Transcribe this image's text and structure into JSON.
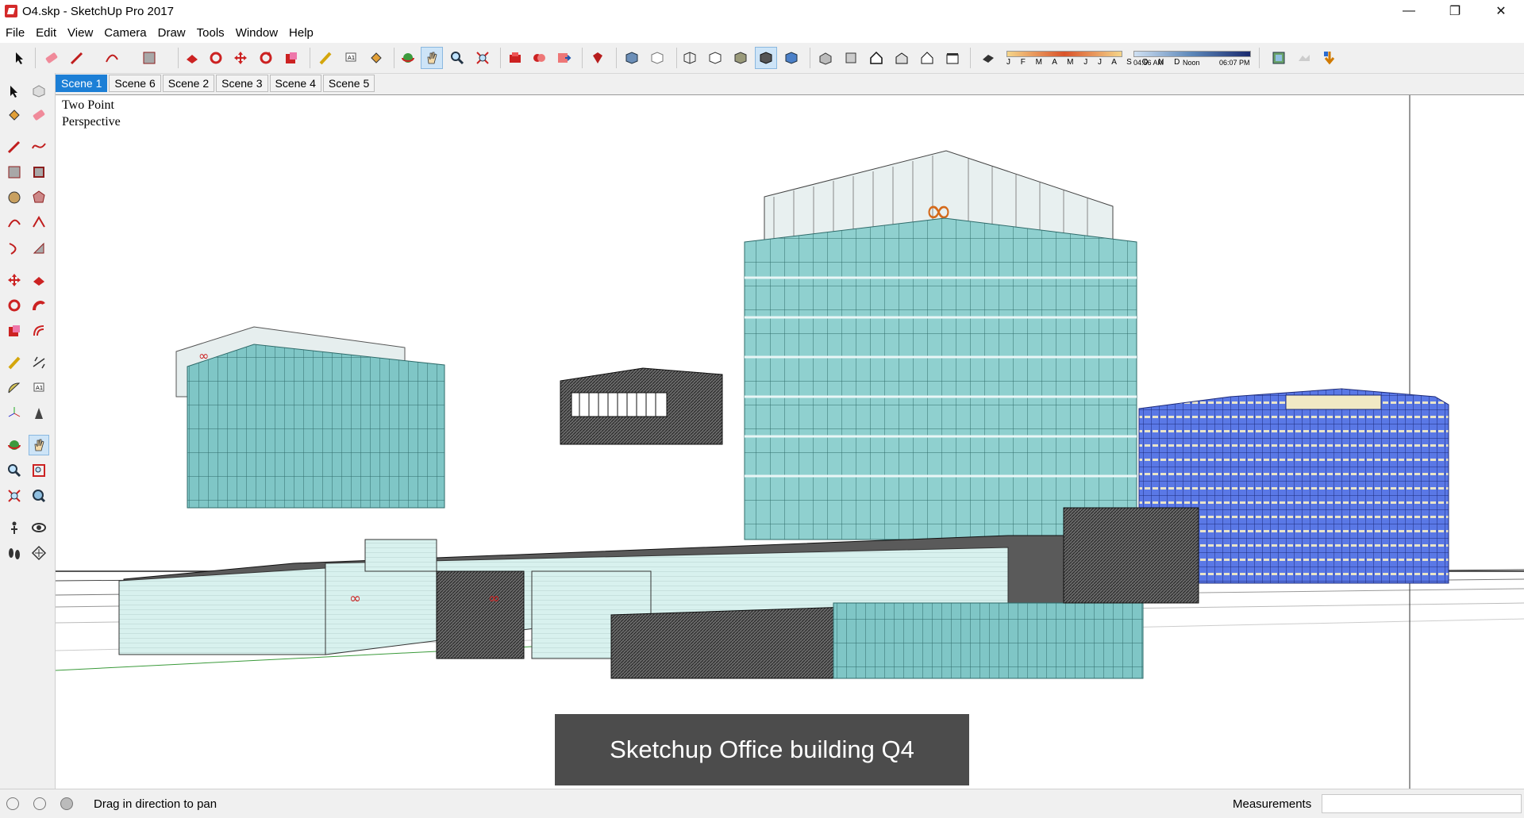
{
  "window": {
    "title": "O4.skp - SketchUp Pro 2017",
    "minimize": "—",
    "maximize": "❐",
    "close": "✕"
  },
  "menu": [
    "File",
    "Edit",
    "View",
    "Camera",
    "Draw",
    "Tools",
    "Window",
    "Help"
  ],
  "shadow_settings": {
    "months": "J F M A M J J A S O N D",
    "sunrise": "04:56 AM",
    "noon": "Noon",
    "sunset": "06:07 PM"
  },
  "scenes": {
    "tabs": [
      "Scene 1",
      "Scene 6",
      "Scene 2",
      "Scene 3",
      "Scene 4",
      "Scene 5"
    ],
    "active": "Scene 1"
  },
  "viewport": {
    "camera_label": "Two Point\nPerspective",
    "caption": "Sketchup Office building Q4"
  },
  "status": {
    "hint": "Drag in direction to pan",
    "measurements_label": "Measurements",
    "measurements_value": ""
  },
  "colors": {
    "glass": "#8fd0cf",
    "glass_dark": "#5fb3b3",
    "residential_blue": "#4f6fe0",
    "active_tab": "#1c7fd6",
    "caption_bg": "#4c4c4c"
  }
}
